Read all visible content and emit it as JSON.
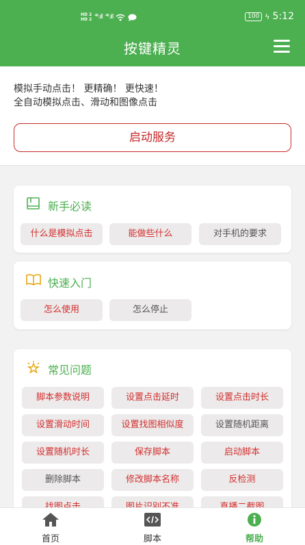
{
  "status_bar": {
    "hd1": "HD 2",
    "hd2": "HD 2",
    "net1": "⁴⁶.ıll",
    "net2": "⁴⁶.ıll",
    "battery": "100",
    "time": "5:12"
  },
  "header": {
    "title": "按键精灵",
    "menu_icon": "menu-icon"
  },
  "intro": {
    "line1": "模拟手动点击！ 更精确！ 更快速！",
    "line2": "全自动模拟点击、滑动和图像点击",
    "start_button": "启动服务"
  },
  "sections": {
    "newbie": {
      "title": "新手必读",
      "icon": "book-icon",
      "chips": [
        "什么是模拟点击",
        "能做些什么",
        "对手机的要求"
      ]
    },
    "quickstart": {
      "title": "快速入门",
      "icon": "open-book-icon",
      "chips": [
        "怎么使用",
        "怎么停止"
      ]
    },
    "faq": {
      "title": "常见问题",
      "icon": "bulb-icon",
      "chips": [
        "脚本参数说明",
        "设置点击延时",
        "设置点击时长",
        "设置滑动时间",
        "设置找图相似度",
        "设置随机距离",
        "设置随机时长",
        "保存脚本",
        "启动脚本",
        "删除脚本",
        "修改脚本名称",
        "反检测",
        "找图点击",
        "图片识别不准",
        "直播二截图"
      ]
    }
  },
  "bottom_nav": {
    "home": "首页",
    "script": "脚本",
    "help": "帮助"
  },
  "colors": {
    "primary": "#4caf50",
    "accent_red": "#d32f2f",
    "chip_bg": "#eceaea"
  }
}
